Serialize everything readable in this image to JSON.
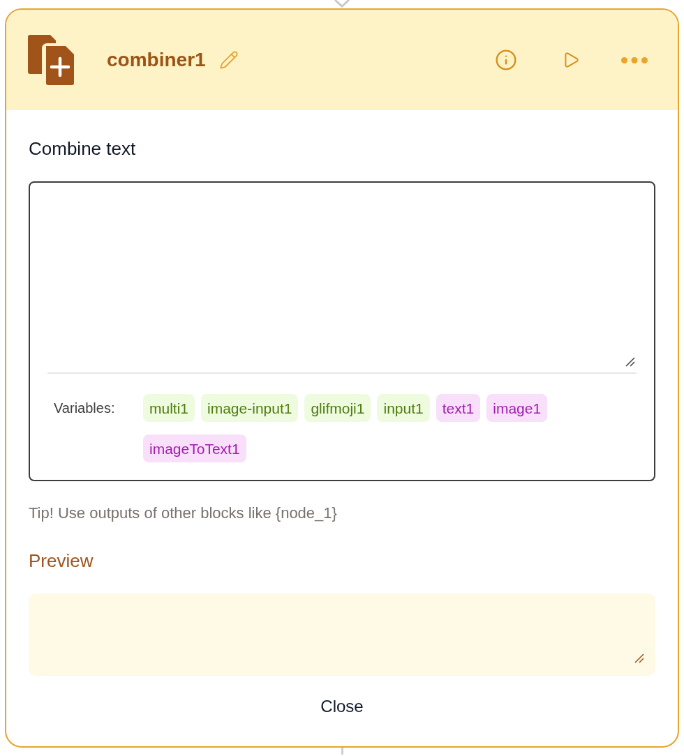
{
  "node": {
    "title": "combiner1"
  },
  "combine_text": {
    "label": "Combine text",
    "variables_label": "Variables:",
    "variables": [
      {
        "name": "multi1",
        "color": "#4d7c0f"
      },
      {
        "name": "image-input1",
        "color": "#4d7c0f"
      },
      {
        "name": "glifmoji1",
        "color": "#4d7c0f"
      },
      {
        "name": "input1",
        "color": "#4d7c0f"
      },
      {
        "name": "text1",
        "color": "#a21caf"
      },
      {
        "name": "image1",
        "color": "#a21caf"
      },
      {
        "name": "imageToText1",
        "color": "#a21caf"
      }
    ]
  },
  "tip": "Tip! Use outputs of other blocks like {node_1}",
  "preview": {
    "label": "Preview"
  },
  "buttons": [
    "Close"
  ]
}
